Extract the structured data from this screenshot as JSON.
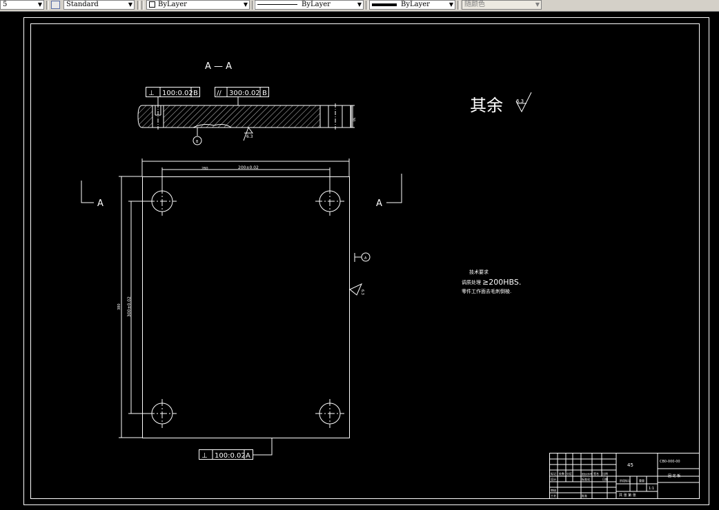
{
  "toolbar": {
    "layer_value": "5",
    "textstyle_value": "Standard",
    "color_value": "ByLayer",
    "linetype_value": "ByLayer",
    "lineweight_value": "ByLayer",
    "plotstyle_value": "随颜色"
  },
  "drawing": {
    "section_title": "A — A",
    "section_mark_left": "A",
    "section_mark_right": "A",
    "fcf_top_left": {
      "symbol": "⊥",
      "value": "100:0.02",
      "datum": "B"
    },
    "fcf_top_right": {
      "symbol": "//",
      "value": "300:0.02",
      "datum": "B"
    },
    "fcf_bottom": {
      "symbol": "⊥",
      "value": "100:0.02",
      "datum": "A"
    },
    "datum_b": "B",
    "datum_a": "A",
    "roughness_section": "6.3",
    "roughness_side": "6.3",
    "roughness_general_prefix": "其余",
    "roughness_general_value": "6.3",
    "dim_outer_width": "280",
    "dim_hole_span_x": "200±0.02",
    "dim_outer_height": "380",
    "dim_hole_span_y": "300±0.02",
    "thickness": "30",
    "tech_req_title": "技术要求",
    "tech_req_line1_prefix": "调质处理",
    "tech_req_line1_value": "≥200HBS.",
    "tech_req_line2": "零件工作面去毛刺倒棱."
  },
  "title_block": {
    "material": "45",
    "drawing_code": "CB0-000-00",
    "part_name": "固 定 板",
    "scale": "1:1",
    "sheet_text": "共 张  第 张",
    "weight_label": "重量",
    "scale_label": "比例",
    "designer_label": "设计",
    "checker_label": "审核",
    "process_label": "工艺",
    "approve_label": "批准",
    "stage_label": "阶段标记",
    "std_label": "标准化",
    "date_label": "日期",
    "sign_label": "签名",
    "mark_label": "标记",
    "count_label": "处数",
    "zone_label": "分区",
    "change_label": "更改文件号"
  },
  "colors": {
    "background": "#000000",
    "lines": "#ffffff",
    "toolbar": "#d4d0c8"
  }
}
